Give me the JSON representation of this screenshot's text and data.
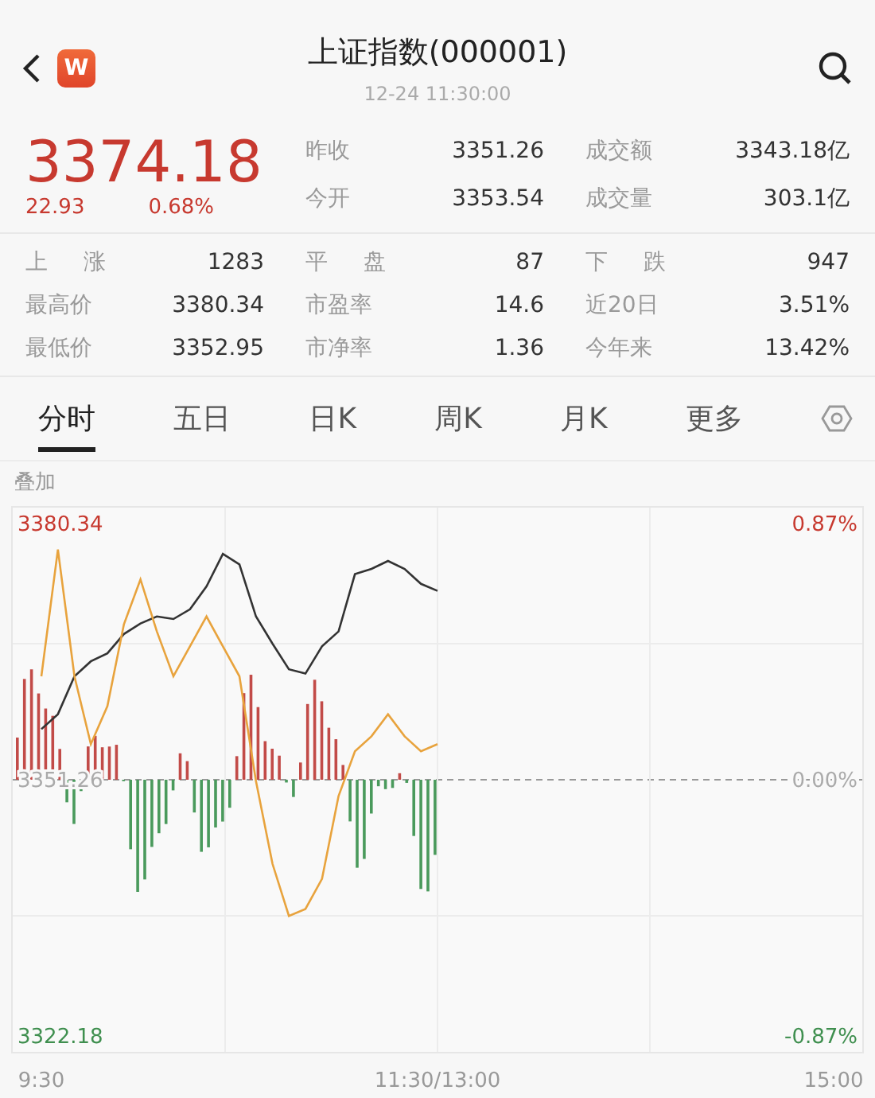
{
  "header": {
    "logo_letter": "W",
    "title": "上证指数(000001)",
    "time": "12-24 11:30:00"
  },
  "quote": {
    "price": "3374.18",
    "change": "22.93",
    "change_pct": "0.68%",
    "fields": [
      {
        "label": "昨收",
        "value": "3351.26"
      },
      {
        "label": "成交额",
        "value": "3343.18亿"
      },
      {
        "label": "今开",
        "value": "3353.54"
      },
      {
        "label": "成交量",
        "value": "303.1亿"
      }
    ]
  },
  "stats": [
    {
      "label": "上 涨",
      "value": "1283"
    },
    {
      "label": "平 盘",
      "value": "87"
    },
    {
      "label": "下 跌",
      "value": "947"
    },
    {
      "label": "最高价",
      "value": "3380.34"
    },
    {
      "label": "市盈率",
      "value": "14.6"
    },
    {
      "label": "近20日",
      "value": "3.51%"
    },
    {
      "label": "最低价",
      "value": "3352.95"
    },
    {
      "label": "市净率",
      "value": "1.36"
    },
    {
      "label": "今年来",
      "value": "13.42%"
    }
  ],
  "tabs": [
    {
      "label": "分时",
      "selected": true
    },
    {
      "label": "五日",
      "selected": false
    },
    {
      "label": "日K",
      "selected": false
    },
    {
      "label": "周K",
      "selected": false
    },
    {
      "label": "月K",
      "selected": false
    },
    {
      "label": "更多",
      "selected": false
    }
  ],
  "chart": {
    "overlay_label": "叠加",
    "right_axis_labels": [
      "0.87%",
      "0.00%",
      "-0.87%"
    ],
    "chart_data": {
      "type": "line",
      "categories": [
        "9:30",
        null,
        null,
        null,
        null,
        null,
        null,
        null,
        null,
        null,
        null,
        null,
        null,
        null,
        null,
        null,
        null,
        null,
        null,
        null,
        null,
        null,
        null,
        null,
        "11:30/13:00",
        null,
        null,
        null,
        null,
        null,
        null,
        null,
        null,
        null,
        null,
        null,
        null,
        null,
        null,
        null,
        null,
        null,
        null,
        null,
        null,
        null,
        null,
        null,
        "15:00"
      ],
      "series": [
        {
          "color": "#333333",
          "values": [
            3357.0,
            3358.7,
            3363.0,
            3364.7,
            3365.6,
            3367.8,
            3369.0,
            3369.8,
            3369.5,
            3370.6,
            3373.2,
            3376.9,
            3375.7,
            3369.8,
            3366.7,
            3363.8,
            3363.3,
            3366.4,
            3368.1,
            3374.6,
            3375.2,
            3376.1,
            3375.2,
            3373.5,
            3372.7,
            null,
            null,
            null,
            null,
            null,
            null,
            null,
            null,
            null,
            null,
            null,
            null,
            null,
            null,
            null,
            null,
            null,
            null,
            null,
            null,
            null,
            null,
            null,
            null
          ]
        },
        {
          "color": "#e8a33d",
          "values": [
            3363.0,
            3377.4,
            3363.0,
            3355.3,
            3359.6,
            3368.9,
            3374.0,
            3368.1,
            3363.0,
            3366.4,
            3369.8,
            3366.4,
            3363.0,
            3351.1,
            3341.7,
            3335.8,
            3336.6,
            3340.0,
            3349.4,
            3354.5,
            3356.2,
            3358.7,
            3356.2,
            3354.5,
            3355.3,
            null,
            null,
            null,
            null,
            null,
            null,
            null,
            null,
            null,
            null,
            null,
            null,
            null,
            null,
            null,
            null,
            null,
            null,
            null,
            null,
            null,
            null,
            null,
            null
          ]
        }
      ],
      "ylim": [
        3320.37,
        3382.15
      ],
      "yticks": [
        {
          "value": 3380.34,
          "label": "3380.34"
        },
        {
          "value": 3351.26,
          "label": "3351.26"
        },
        {
          "value": 3322.18,
          "label": "3322.18"
        }
      ]
    }
  }
}
